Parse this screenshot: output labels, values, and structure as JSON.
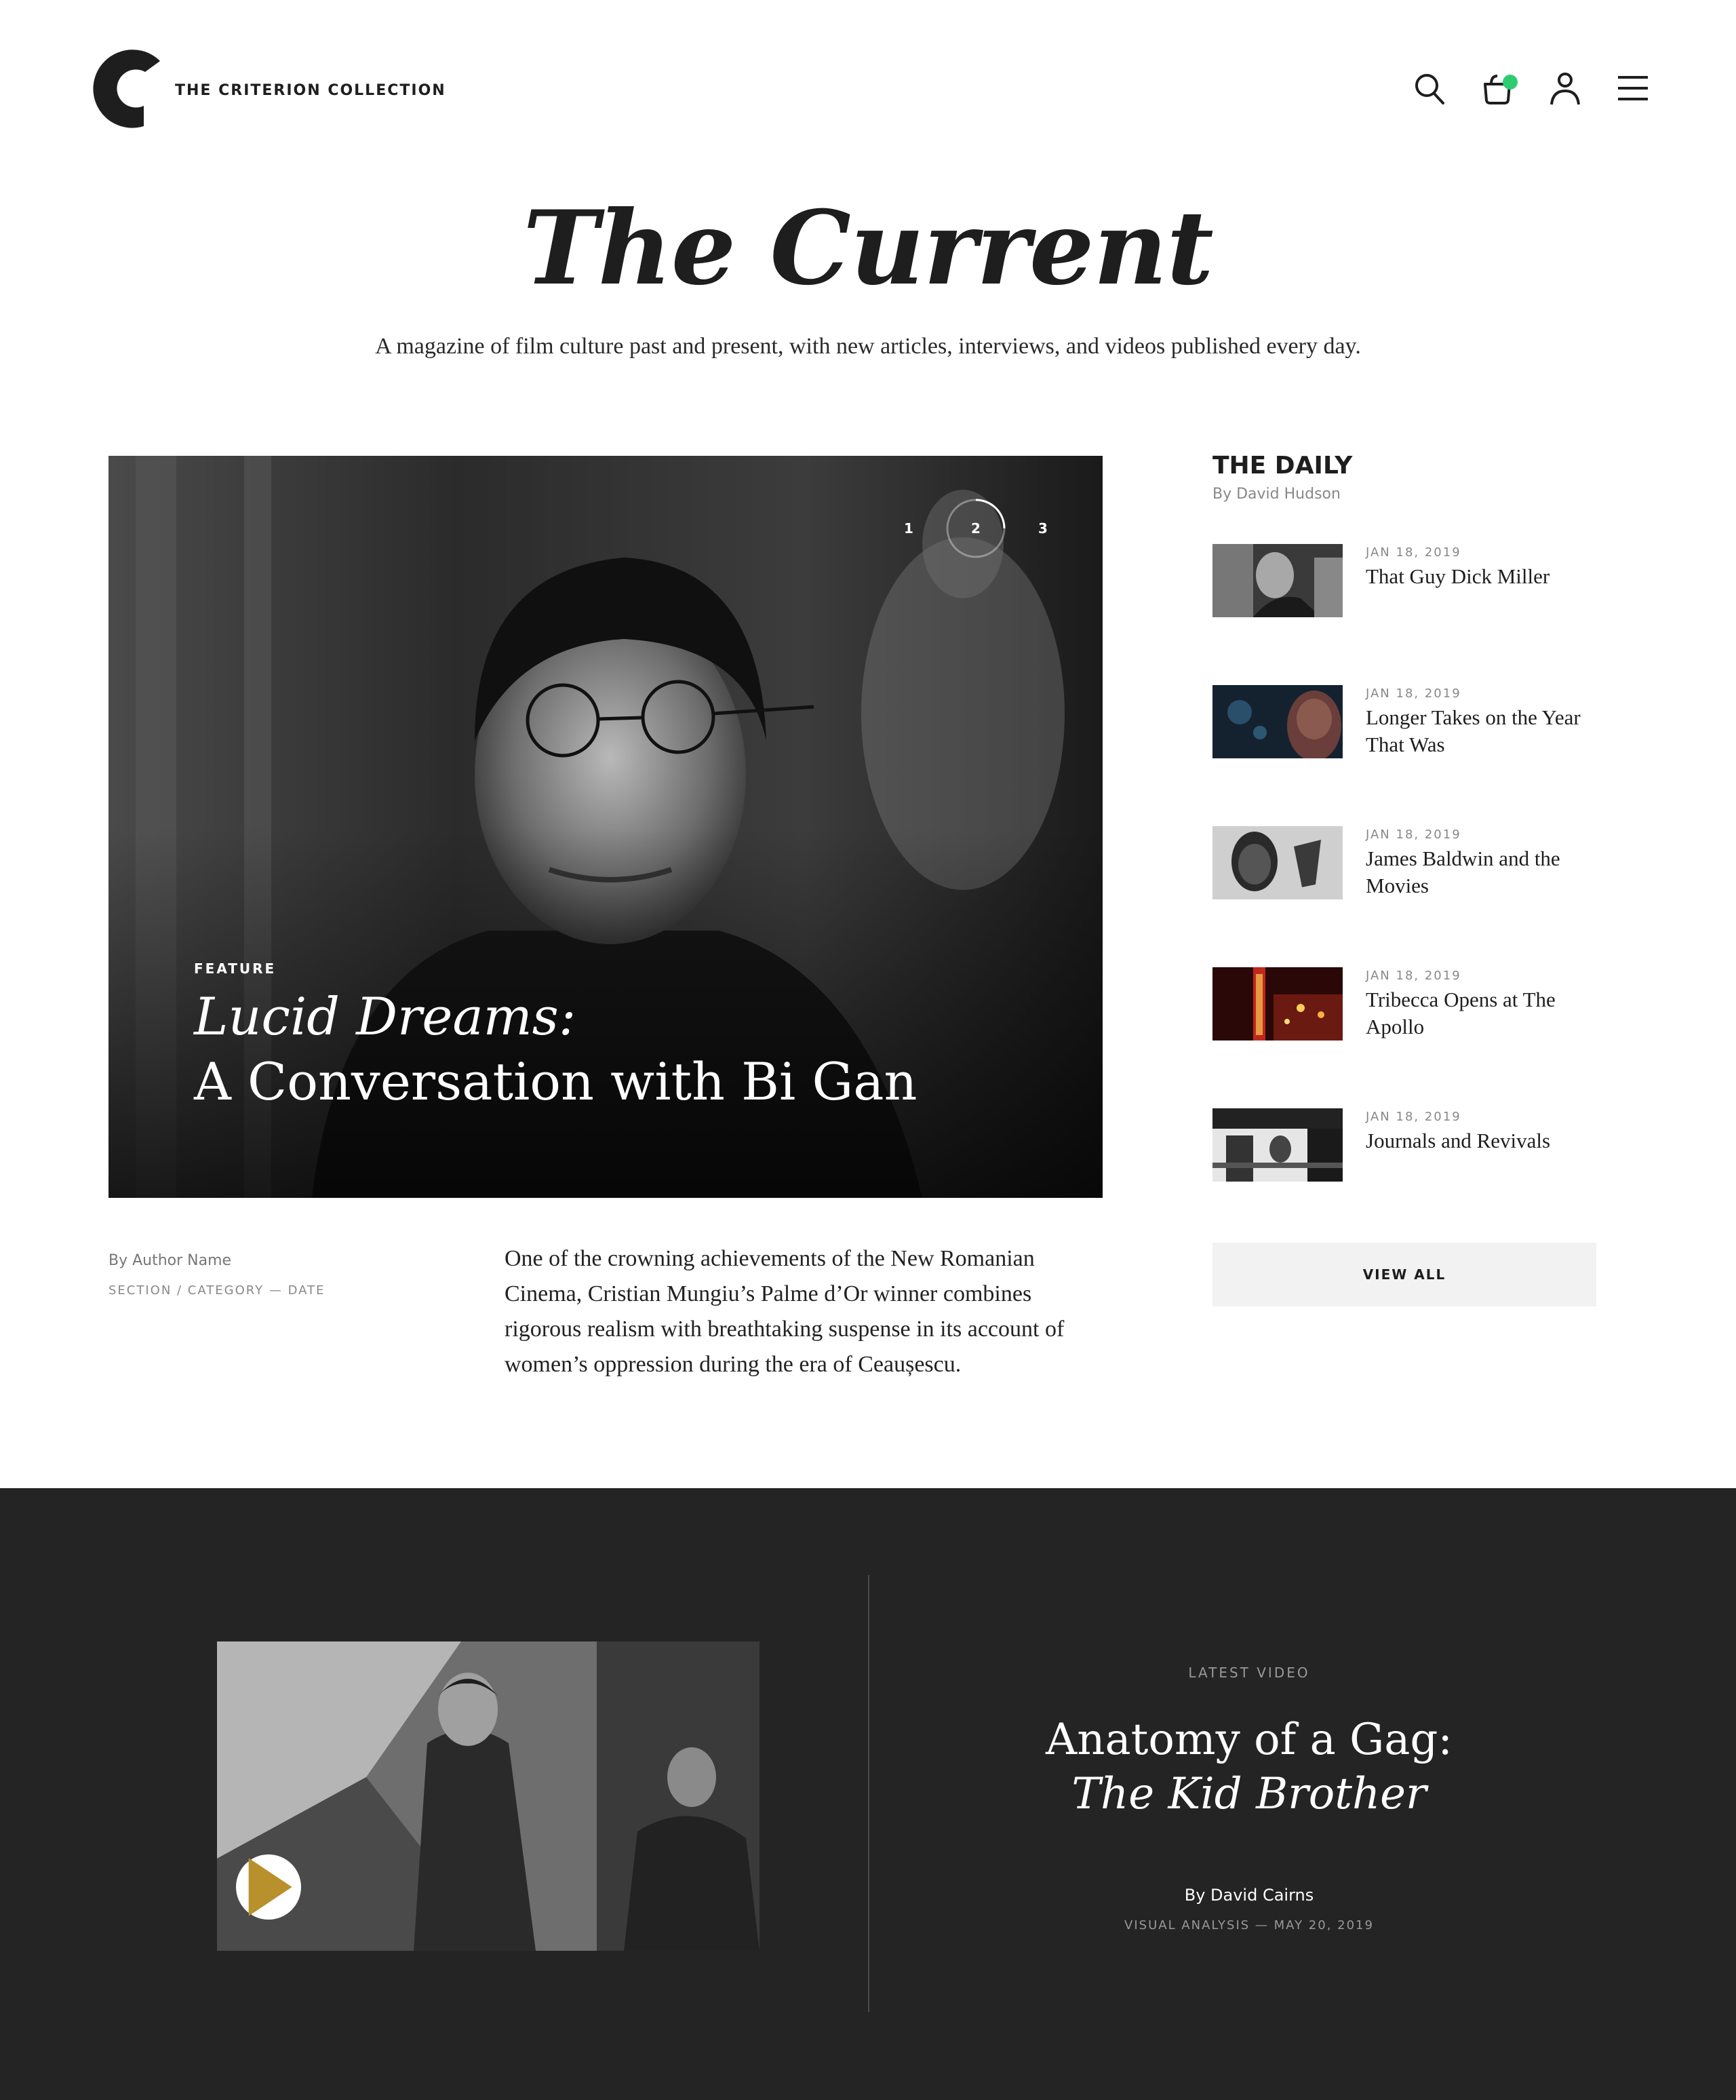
{
  "header": {
    "brand": "THE  CRITERION  COLLECTION",
    "icons": [
      "search-icon",
      "cart-icon",
      "user-icon",
      "menu-icon"
    ],
    "cart_indicator_color": "#2ecc71"
  },
  "hero": {
    "title": "The Current",
    "subtitle": "A magazine of film culture past and present, with new articles, interviews, and videos published every day."
  },
  "feature": {
    "tag": "FEATURE",
    "title_line1": "Lucid Dreams:",
    "title_line2": "A Conversation with Bi Gan",
    "carousel": [
      "1",
      "2",
      "3"
    ],
    "carousel_active": "2",
    "byline": "By Author Name",
    "meta": "SECTION  /  CATEGORY  —  DATE",
    "excerpt": "One of the crowning achievements of the New Romanian Cinema, Cristian Mungiu’s Palme d’Or winner combines rigorous realism with breathtaking suspense in its account of women’s oppression during the era of Ceaușescu."
  },
  "daily": {
    "title": "THE DAILY",
    "byline": "By David Hudson",
    "items": [
      {
        "date": "JAN 18, 2019",
        "headline": "That Guy Dick Miller"
      },
      {
        "date": "JAN 18, 2019",
        "headline": "Longer Takes on the Year That Was"
      },
      {
        "date": "JAN 18, 2019",
        "headline": "James Baldwin and the Movies"
      },
      {
        "date": "JAN 18, 2019",
        "headline": "Tribecca Opens at The Apollo"
      },
      {
        "date": "JAN 18, 2019",
        "headline": "Journals and Revivals"
      }
    ],
    "view_all": "VIEW ALL"
  },
  "video": {
    "label": "LATEST VIDEO",
    "title_line1": "Anatomy of a Gag:",
    "title_line2": "The Kid Brother",
    "byline": "By David Cairns",
    "meta": "VISUAL ANALYSIS  —  MAY 20, 2019",
    "play_icon_color": "#b8902c"
  }
}
